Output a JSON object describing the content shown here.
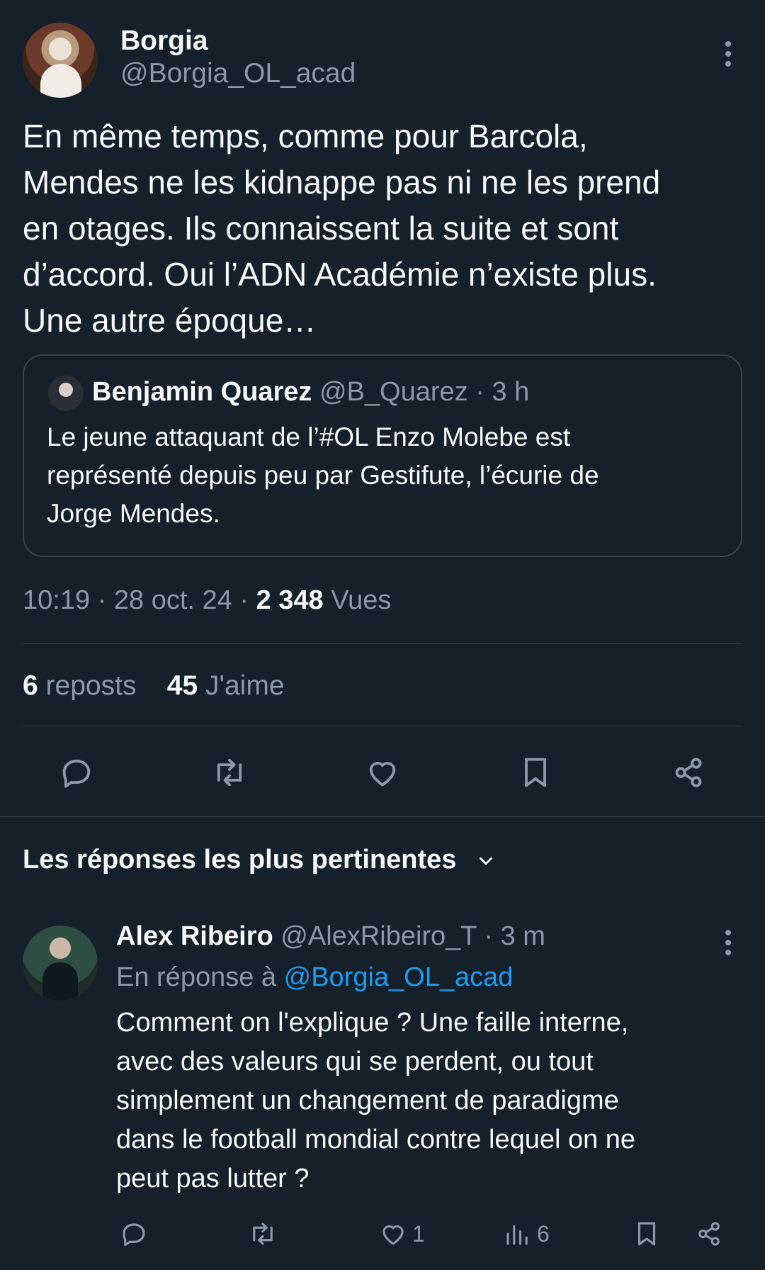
{
  "tweet": {
    "author": {
      "name": "Borgia",
      "handle": "@Borgia_OL_acad"
    },
    "text": "En même temps, comme pour Barcola,\nMendes ne les kidnappe pas ni ne les prend\nen otages. Ils connaissent la suite et sont\nd’accord. Oui l’ADN Académie n’existe plus.\nUne autre époque…",
    "time": "10:19",
    "sep": "·",
    "date": "28 oct. 24",
    "views_count": "2 348",
    "views_label": "Vues",
    "reposts_count": "6",
    "reposts_label": "reposts",
    "likes_count": "45",
    "likes_label": "J'aime"
  },
  "quote": {
    "name": "Benjamin Quarez",
    "handle": "@B_Quarez",
    "time": "· 3 h",
    "text": "Le jeune attaquant de l’#OL Enzo Molebe est\nreprésenté depuis peu par Gestifute, l’écurie de\nJorge Mendes."
  },
  "actions": {
    "icons": [
      "reply-icon",
      "repost-icon",
      "like-icon",
      "bookmark-icon",
      "share-icon"
    ]
  },
  "replies_sort": {
    "label": "Les réponses les plus pertinentes",
    "icon": "chevron-down-icon"
  },
  "reply": {
    "name": "Alex Ribeiro",
    "handle": "@AlexRibeiro_T",
    "time": "· 3 m",
    "reply_to_prefix": "En réponse à",
    "reply_to_handle": "@Borgia_OL_acad",
    "text": "Comment on l'explique ? Une faille interne,\navec des valeurs qui se perdent, ou tout\nsimplement un changement de paradigme\ndans le football mondial contre lequel on ne\npeut pas lutter ?",
    "likes": "1",
    "views": "6"
  },
  "colors": {
    "background": "#15202b",
    "text": "#f7f9f9",
    "muted": "#8b98a5",
    "border": "#38444d",
    "link": "#1d9bf0"
  }
}
